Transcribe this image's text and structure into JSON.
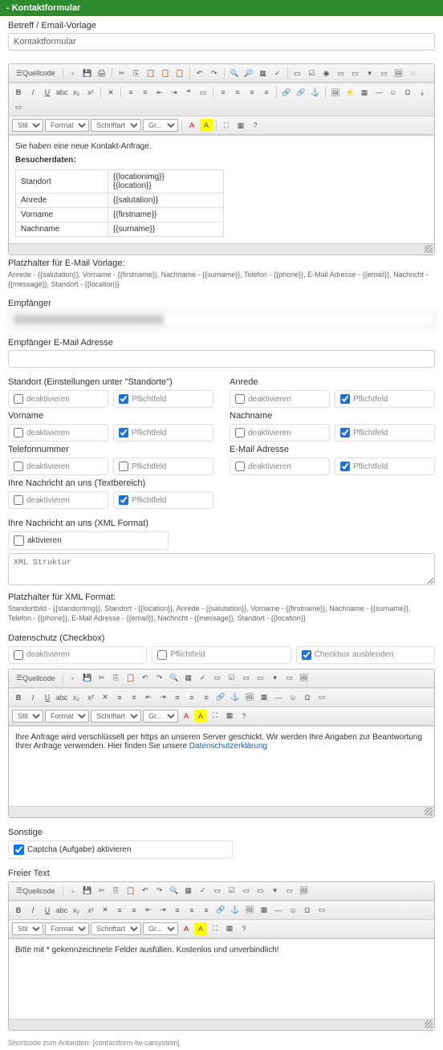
{
  "header": {
    "title": "- Kontaktformular"
  },
  "subject": {
    "label": "Betreff / Email-Vorlage",
    "value": "Kontaktformular"
  },
  "editor1": {
    "intro": "Sie haben eine neue Kontakt-Anfrage.",
    "visitor_label": "Besucherdaten:",
    "table": [
      [
        "Standort",
        "{{locationimg}}\n{{location}}"
      ],
      [
        "Anrede",
        "{{salutation}}"
      ],
      [
        "Vorname",
        "{{firstname}}"
      ],
      [
        "Nachname",
        "{{surname}}"
      ]
    ]
  },
  "placeholders1": {
    "label": "Platzhalter für E-Mail Vorlage:",
    "text": "Anrede - {{salutation}}, Vorname - {{firstname}}, Nachname - {{surname}}, Telefon - {{phone}}, E-Mail Adresse - {{email}}, Nachricht - {{message}}, Standort - {{location}}"
  },
  "recipient": {
    "label": "Empfänger",
    "value": "████████████████████████"
  },
  "recipient_email": {
    "label": "Empfänger E-Mail Adresse",
    "value": ""
  },
  "fields": [
    {
      "title": "Standort (Einstellungen unter \"Standorte\")",
      "deact": false,
      "required": true
    },
    {
      "title": "Anrede",
      "deact": false,
      "required": true
    },
    {
      "title": "Vorname",
      "deact": false,
      "required": true
    },
    {
      "title": "Nachname",
      "deact": false,
      "required": true
    },
    {
      "title": "Telefonnummer",
      "deact": false,
      "required": false
    },
    {
      "title": "E-Mail Adresse",
      "deact": false,
      "required": true
    },
    {
      "title": "Ihre Nachricht an uns (Textbereich)",
      "deact": false,
      "required": true
    }
  ],
  "check_labels": {
    "deactivate": "deaktivieren",
    "required": "Pflichtfeld",
    "activate": "aktivieren",
    "hide_checkbox": "Checkbox ausblenden"
  },
  "xml": {
    "title": "Ihre Nachricht an uns (XML Format)",
    "activate": false,
    "placeholder": "XML Struktur"
  },
  "placeholders_xml": {
    "label": "Platzhalter für XML Format:",
    "text": "Standortbild - {{standortimg}}, Standort - {{location}}, Anrede - {{salutation}}, Vorname - {{firstname}}, Nachname - {{surname}}, Telefon - {{phone}}, E-Mail Adresse - {{email}}, Nachricht - {{message}}, Standort - {{location}}"
  },
  "privacy": {
    "title": "Datenschutz (Checkbox)",
    "deact": false,
    "required": false,
    "hide": true,
    "content_prefix": "Ihre Anfrage wird verschlüsselt per https an unseren Server geschickt. Wir werden Ihre Angaben zur Beantwortung Ihrer Anfrage verwenden. Hier finden Sie unsere ",
    "content_link": "Datenschutzerklärung"
  },
  "misc": {
    "title": "Sonstige",
    "captcha_label": "Captcha (Aufgabe) aktivieren",
    "captcha": true
  },
  "freetext": {
    "title": "Freier Text",
    "content": "Bitte mit * gekennzeichnete Felder ausfüllen. Kostenlos und unverbindlich!"
  },
  "toolbar": {
    "source": "Quellcode",
    "style": "Stil",
    "format": "Format",
    "font": "Schriftart",
    "size": "Gr..."
  },
  "footer": {
    "label": "Shortcode zum Anbinden:",
    "value": "[contactform-fw-carsystem]"
  }
}
